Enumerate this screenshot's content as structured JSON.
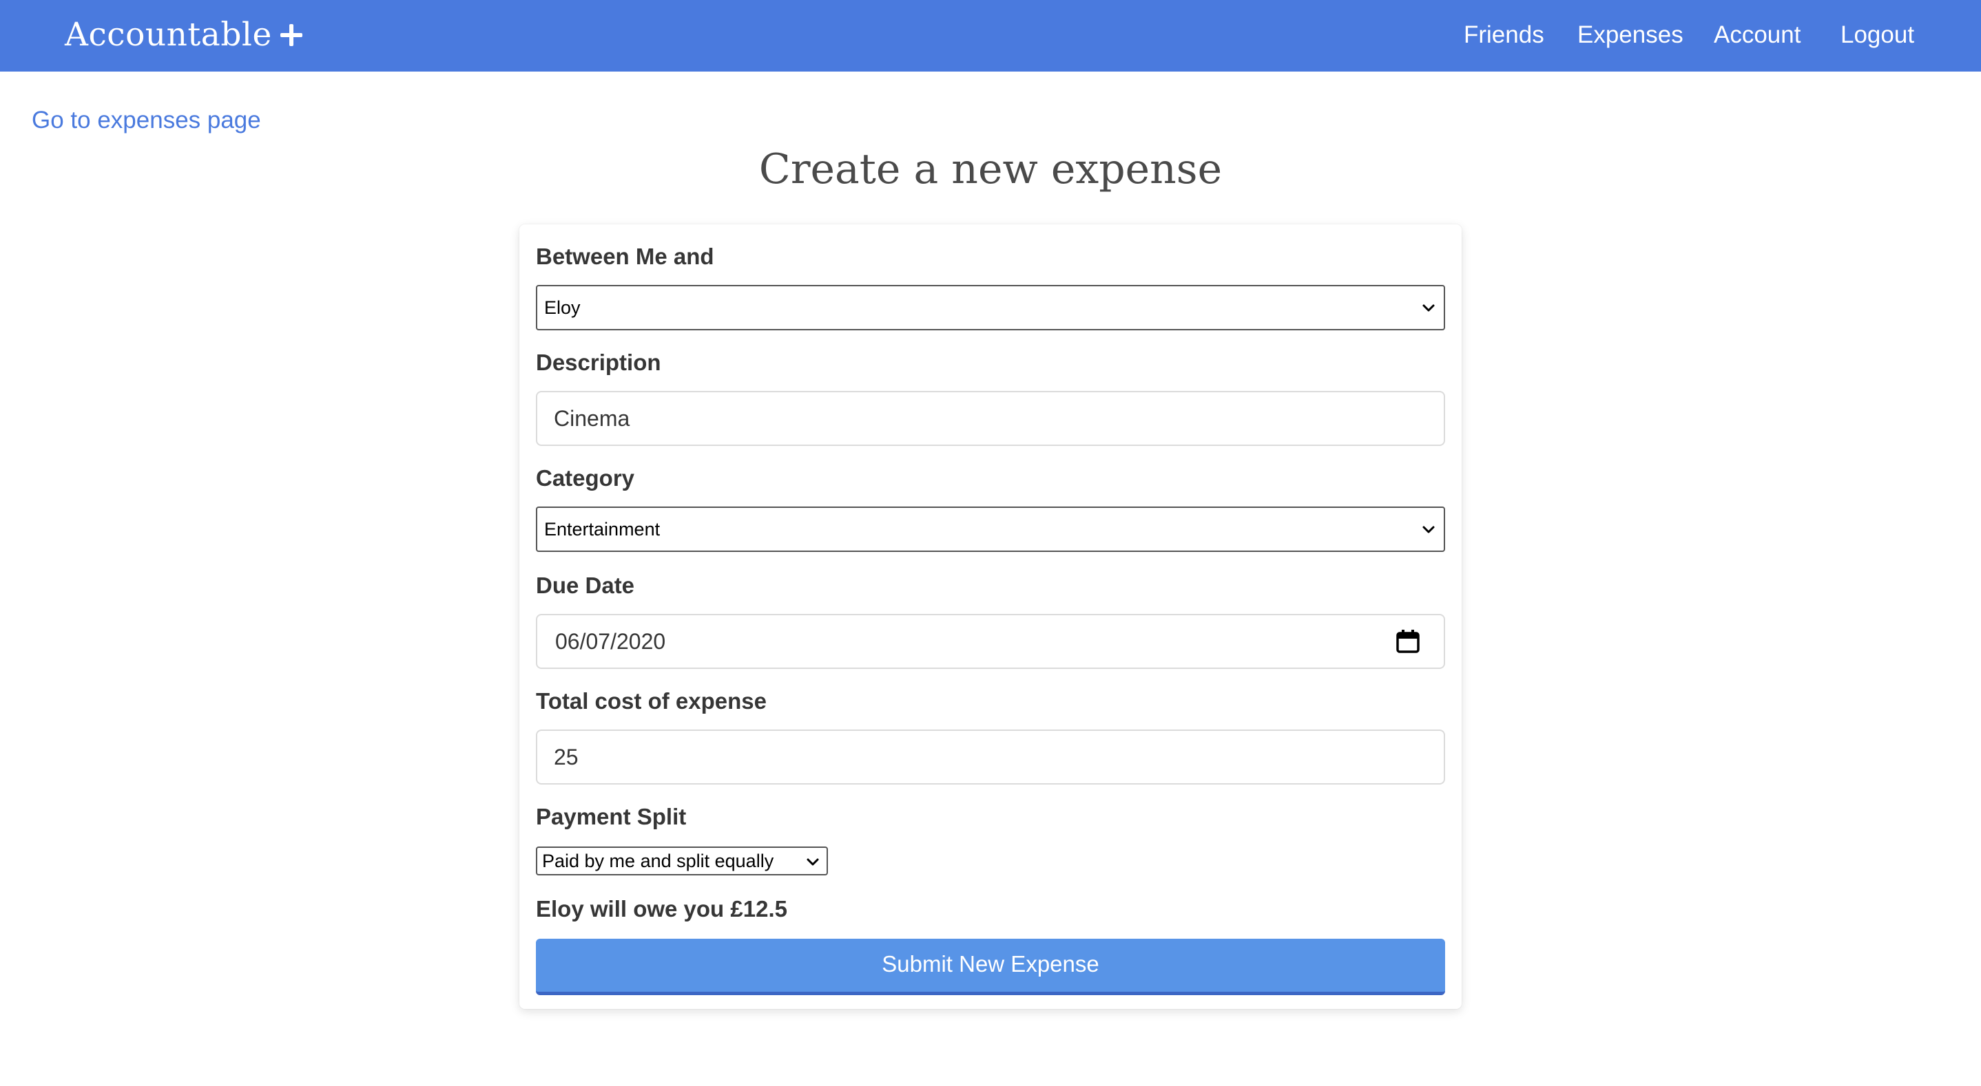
{
  "navbar": {
    "brand": "Accountable",
    "add_icon": "plus-icon",
    "links": {
      "friends": "Friends",
      "expenses": "Expenses",
      "account": "Account",
      "logout": "Logout"
    }
  },
  "back_link": "Go to expenses page",
  "page_title": "Create a new expense",
  "form": {
    "between_label": "Between Me and",
    "between_value": "Eloy",
    "description_label": "Description",
    "description_value": "Cinema",
    "category_label": "Category",
    "category_value": "Entertainment",
    "due_date_label": "Due Date",
    "due_date_value": "06/07/2020",
    "total_cost_label": "Total cost of expense",
    "total_cost_value": "25",
    "payment_split_label": "Payment Split",
    "payment_split_value": "Paid by me and split equally",
    "owe_summary": "Eloy will owe you £12.5",
    "submit_label": "Submit New Expense"
  },
  "colors": {
    "navbar_bg": "#4a7ade",
    "link": "#4a7ade",
    "button_bg": "#5894e7"
  }
}
